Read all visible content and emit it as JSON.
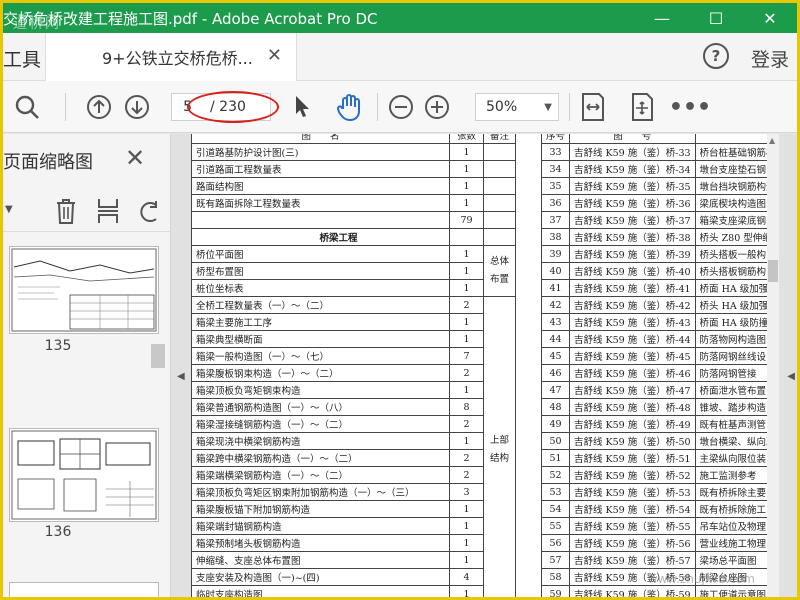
{
  "window": {
    "title": "交桥危桥改建工程施工图.pdf - Adobe Acrobat Pro DC",
    "logo_text": "道桥网"
  },
  "tabs": {
    "tools_label": "工具",
    "doc_tab_label": "9+公铁立交桥危桥...",
    "login_label": "登录"
  },
  "toolbar": {
    "current_page": "5",
    "total_pages": "/ 230",
    "zoom": "50%"
  },
  "thumbnails": {
    "title": "页面缩略图",
    "pages": [
      "135",
      "136"
    ]
  },
  "table_left": {
    "headers": [
      "图　　名",
      "张数",
      "备注"
    ],
    "rows": [
      {
        "name": "引道路基防护设计图(三)",
        "count": "1"
      },
      {
        "name": "引道路面工程数量表",
        "count": "1"
      },
      {
        "name": "路面结构图",
        "count": "1"
      },
      {
        "name": "既有路面拆除工程数量表",
        "count": "1"
      },
      {
        "name": "",
        "count": "79"
      },
      {
        "name": "桥梁工程",
        "count": "",
        "section": true
      },
      {
        "name": "桥位平面图",
        "count": "1"
      },
      {
        "name": "桥型布置图",
        "count": "1"
      },
      {
        "name": "桩位坐标表",
        "count": "1"
      },
      {
        "name": "全桥工程数量表（一）～（二）",
        "count": "2"
      },
      {
        "name": "箱梁主要施工工序",
        "count": "1"
      },
      {
        "name": "箱梁典型横断面",
        "count": "1"
      },
      {
        "name": "箱梁一般构造图（一）～（七）",
        "count": "7"
      },
      {
        "name": "箱梁腹板钢束构造（一）～（二）",
        "count": "2"
      },
      {
        "name": "箱梁顶板负弯矩钢束构造",
        "count": "1"
      },
      {
        "name": "箱梁普通钢筋构造图（一）～（八）",
        "count": "8"
      },
      {
        "name": "箱梁湿接缝钢筋构造（一）～（二）",
        "count": "2"
      },
      {
        "name": "箱梁现浇中横梁钢筋构造",
        "count": "1"
      },
      {
        "name": "箱梁跨中横梁钢筋构造（一）～（二）",
        "count": "2"
      },
      {
        "name": "箱梁端横梁钢筋构造（一）～（二）",
        "count": "2"
      },
      {
        "name": "箱梁顶板负弯矩区钢束附加钢筋构造（一）～（三）",
        "count": "3"
      },
      {
        "name": "箱梁腹板锚下附加钢筋构造",
        "count": "1"
      },
      {
        "name": "箱梁端封锚钢筋构造",
        "count": "1"
      },
      {
        "name": "箱梁预制堵头板钢筋构造",
        "count": "1"
      },
      {
        "name": "伸缩缝、支座总体布置图",
        "count": "1"
      },
      {
        "name": "支座安装及构造图（一)~(四)",
        "count": "4"
      },
      {
        "name": "临时支座构造图",
        "count": "1"
      }
    ],
    "note_overall": "总体\n布置",
    "note_upper": "上部\n结构"
  },
  "table_right": {
    "headers": [
      "序号",
      "图　　号",
      ""
    ],
    "rows": [
      {
        "seq": "33",
        "code": "吉舒线 K59 施（鉴）桥-33",
        "title": "桥台桩基础钢筋构"
      },
      {
        "seq": "34",
        "code": "吉舒线 K59 施（鉴）桥-34",
        "title": "墩台支座垫石钢"
      },
      {
        "seq": "35",
        "code": "吉舒线 K59 施（鉴）桥-35",
        "title": "墩台挡块钢筋构造"
      },
      {
        "seq": "36",
        "code": "吉舒线 K59 施（鉴）桥-36",
        "title": "梁底楔块构造图"
      },
      {
        "seq": "37",
        "code": "吉舒线 K59 施（鉴）桥-37",
        "title": "箱梁支座梁底钢"
      },
      {
        "seq": "38",
        "code": "吉舒线 K59 施（鉴）桥-38",
        "title": "桥头 Z80 型伸缩"
      },
      {
        "seq": "39",
        "code": "吉舒线 K59 施（鉴）桥-39",
        "title": "桥头搭板一般构"
      },
      {
        "seq": "40",
        "code": "吉舒线 K59 施（鉴）桥-40",
        "title": "桥头搭板钢筋构"
      },
      {
        "seq": "41",
        "code": "吉舒线 K59 施（鉴）桥-41",
        "title": "桥面 HA 级加强"
      },
      {
        "seq": "42",
        "code": "吉舒线 K59 施（鉴）桥-42",
        "title": "桥头 HA 级加强"
      },
      {
        "seq": "43",
        "code": "吉舒线 K59 施（鉴）桥-43",
        "title": "桥面 HA 级防撞"
      },
      {
        "seq": "44",
        "code": "吉舒线 K59 施（鉴）桥-44",
        "title": "防落物网构造图"
      },
      {
        "seq": "45",
        "code": "吉舒线 K59 施（鉴）桥-45",
        "title": "防落网钢丝线设"
      },
      {
        "seq": "46",
        "code": "吉舒线 K59 施（鉴）桥-46",
        "title": "防落网钢管接"
      },
      {
        "seq": "47",
        "code": "吉舒线 K59 施（鉴）桥-47",
        "title": "桥面泄水管布置"
      },
      {
        "seq": "48",
        "code": "吉舒线 K59 施（鉴）桥-48",
        "title": "锥坡、踏步构造"
      },
      {
        "seq": "49",
        "code": "吉舒线 K59 施（鉴）桥-49",
        "title": "既有桩基声测管"
      },
      {
        "seq": "50",
        "code": "吉舒线 K59 施（鉴）桥-50",
        "title": "墩台横梁、纵向减"
      },
      {
        "seq": "51",
        "code": "吉舒线 K59 施（鉴）桥-51",
        "title": "主梁纵向限位装"
      },
      {
        "seq": "52",
        "code": "吉舒线 K59 施（鉴）桥-52",
        "title": "施工监测参考"
      },
      {
        "seq": "53",
        "code": "吉舒线 K59 施（鉴）桥-53",
        "title": "既有桥拆除主要"
      },
      {
        "seq": "54",
        "code": "吉舒线 K59 施（鉴）桥-54",
        "title": "既有桥拆除施工"
      },
      {
        "seq": "55",
        "code": "吉舒线 K59 施（鉴）桥-55",
        "title": "吊车站位及物理"
      },
      {
        "seq": "56",
        "code": "吉舒线 K59 施（鉴）桥-56",
        "title": "营业线施工物理"
      },
      {
        "seq": "57",
        "code": "吉舒线 K59 施（鉴）桥-57",
        "title": "梁场总平面图"
      },
      {
        "seq": "58",
        "code": "吉舒线 K59 施（鉴）桥-58",
        "title": "制梁台座图"
      },
      {
        "seq": "59",
        "code": "吉舒线 K59 施（鉴）桥-59",
        "title": "施工便道示意图"
      }
    ]
  },
  "watermark": "www.zhujiwu.com",
  "colors": {
    "titlebar": "#1c9b4c",
    "frame": "#e8c600",
    "annotation": "#d9201a"
  }
}
